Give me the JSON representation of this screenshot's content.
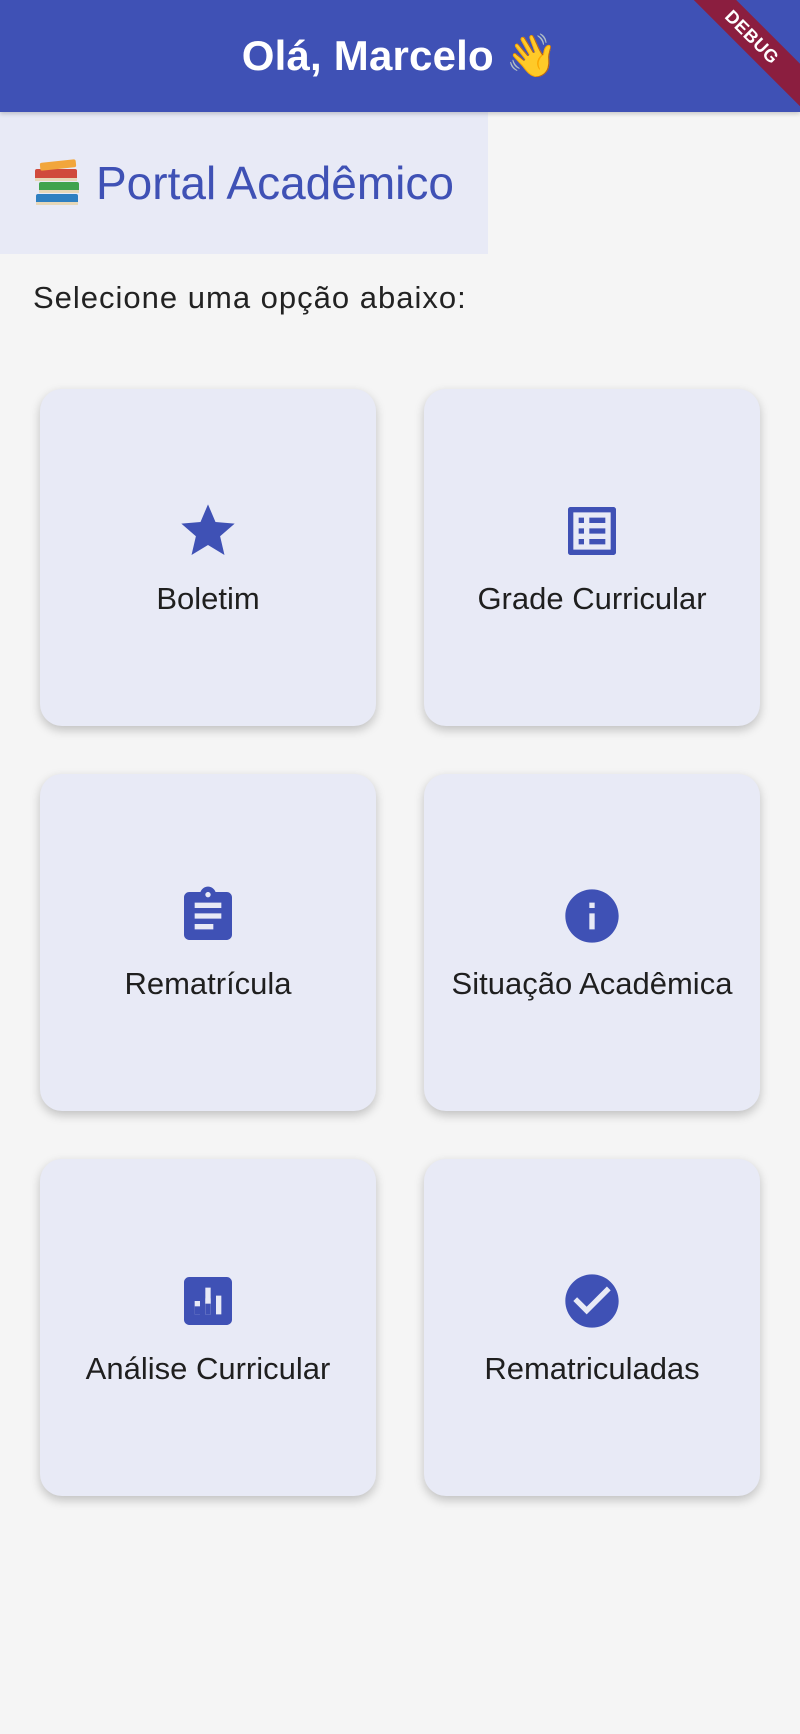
{
  "appbar": {
    "title": "Olá, Marcelo 👋",
    "debug_label": "DEBUG"
  },
  "header": {
    "title": "Portal Acadêmico",
    "icon": "books-icon"
  },
  "subtitle": "Selecione uma opção abaixo:",
  "cards": [
    {
      "label": "Boletim",
      "icon": "star-icon"
    },
    {
      "label": "Grade Curricular",
      "icon": "list-icon"
    },
    {
      "label": "Rematrícula",
      "icon": "clipboard-icon"
    },
    {
      "label": "Situação Acadêmica",
      "icon": "info-icon"
    },
    {
      "label": "Análise Curricular",
      "icon": "bar-chart-icon"
    },
    {
      "label": "Rematriculadas",
      "icon": "check-circle-icon"
    }
  ],
  "colors": {
    "primary": "#3f51b5",
    "card_background": "#e8eaf6",
    "page_background": "#f5f5f5",
    "debug_banner": "#8b1e3f"
  }
}
